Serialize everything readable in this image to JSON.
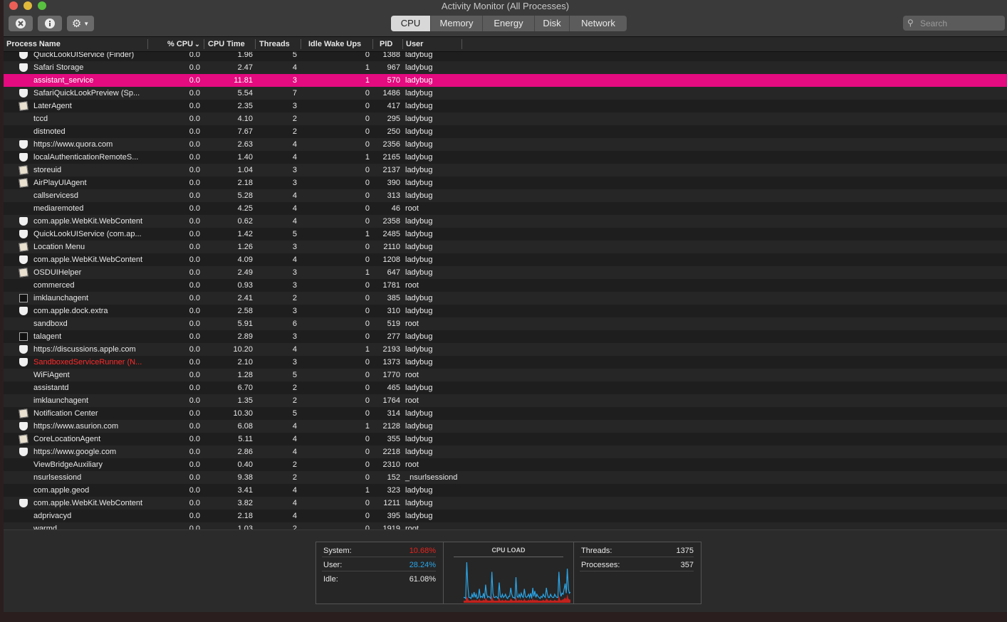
{
  "window": {
    "title": "Activity Monitor (All Processes)"
  },
  "toolbar": {
    "tabs": [
      {
        "label": "CPU",
        "active": true,
        "width": 55
      },
      {
        "label": "Memory",
        "active": false,
        "width": 72
      },
      {
        "label": "Energy",
        "active": false,
        "width": 72
      },
      {
        "label": "Disk",
        "active": false,
        "width": 48
      },
      {
        "label": "Network",
        "active": false,
        "width": 80
      }
    ],
    "search_placeholder": "Search"
  },
  "columns": {
    "name": "Process Name",
    "cpu": "% CPU",
    "cpu_time": "CPU Time",
    "threads": "Threads",
    "idle": "Idle Wake Ups",
    "pid": "PID",
    "user": "User"
  },
  "processes": [
    {
      "name": "QuickLookUIService (Finder)",
      "cpu": "0.0",
      "time": "1.96",
      "threads": "5",
      "idle": "0",
      "pid": "1388",
      "user": "ladybug",
      "icon": "shield"
    },
    {
      "name": "Safari Storage",
      "cpu": "0.0",
      "time": "2.47",
      "threads": "4",
      "idle": "1",
      "pid": "967",
      "user": "ladybug",
      "icon": "shield"
    },
    {
      "name": "assistant_service",
      "cpu": "0.0",
      "time": "11.81",
      "threads": "3",
      "idle": "1",
      "pid": "570",
      "user": "ladybug",
      "icon": "none",
      "selected": true
    },
    {
      "name": "SafariQuickLookPreview (Sp...",
      "cpu": "0.0",
      "time": "5.54",
      "threads": "7",
      "idle": "0",
      "pid": "1486",
      "user": "ladybug",
      "icon": "shield"
    },
    {
      "name": "LaterAgent",
      "cpu": "0.0",
      "time": "2.35",
      "threads": "3",
      "idle": "0",
      "pid": "417",
      "user": "ladybug",
      "icon": "app"
    },
    {
      "name": "tccd",
      "cpu": "0.0",
      "time": "4.10",
      "threads": "2",
      "idle": "0",
      "pid": "295",
      "user": "ladybug",
      "icon": "none"
    },
    {
      "name": "distnoted",
      "cpu": "0.0",
      "time": "7.67",
      "threads": "2",
      "idle": "0",
      "pid": "250",
      "user": "ladybug",
      "icon": "none"
    },
    {
      "name": "https://www.quora.com",
      "cpu": "0.0",
      "time": "2.63",
      "threads": "4",
      "idle": "0",
      "pid": "2356",
      "user": "ladybug",
      "icon": "shield"
    },
    {
      "name": "localAuthenticationRemoteS...",
      "cpu": "0.0",
      "time": "1.40",
      "threads": "4",
      "idle": "1",
      "pid": "2165",
      "user": "ladybug",
      "icon": "shield"
    },
    {
      "name": "storeuid",
      "cpu": "0.0",
      "time": "1.04",
      "threads": "3",
      "idle": "0",
      "pid": "2137",
      "user": "ladybug",
      "icon": "app"
    },
    {
      "name": "AirPlayUIAgent",
      "cpu": "0.0",
      "time": "2.18",
      "threads": "3",
      "idle": "0",
      "pid": "390",
      "user": "ladybug",
      "icon": "app"
    },
    {
      "name": "callservicesd",
      "cpu": "0.0",
      "time": "5.28",
      "threads": "4",
      "idle": "0",
      "pid": "313",
      "user": "ladybug",
      "icon": "none"
    },
    {
      "name": "mediaremoted",
      "cpu": "0.0",
      "time": "4.25",
      "threads": "4",
      "idle": "0",
      "pid": "46",
      "user": "root",
      "icon": "none"
    },
    {
      "name": "com.apple.WebKit.WebContent",
      "cpu": "0.0",
      "time": "0.62",
      "threads": "4",
      "idle": "0",
      "pid": "2358",
      "user": "ladybug",
      "icon": "shield"
    },
    {
      "name": "QuickLookUIService (com.ap...",
      "cpu": "0.0",
      "time": "1.42",
      "threads": "5",
      "idle": "1",
      "pid": "2485",
      "user": "ladybug",
      "icon": "shield"
    },
    {
      "name": "Location Menu",
      "cpu": "0.0",
      "time": "1.26",
      "threads": "3",
      "idle": "0",
      "pid": "2110",
      "user": "ladybug",
      "icon": "app"
    },
    {
      "name": "com.apple.WebKit.WebContent",
      "cpu": "0.0",
      "time": "4.09",
      "threads": "4",
      "idle": "0",
      "pid": "1208",
      "user": "ladybug",
      "icon": "shield"
    },
    {
      "name": "OSDUIHelper",
      "cpu": "0.0",
      "time": "2.49",
      "threads": "3",
      "idle": "1",
      "pid": "647",
      "user": "ladybug",
      "icon": "app"
    },
    {
      "name": "commerced",
      "cpu": "0.0",
      "time": "0.93",
      "threads": "3",
      "idle": "0",
      "pid": "1781",
      "user": "root",
      "icon": "none"
    },
    {
      "name": "imklaunchagent",
      "cpu": "0.0",
      "time": "2.41",
      "threads": "2",
      "idle": "0",
      "pid": "385",
      "user": "ladybug",
      "icon": "term"
    },
    {
      "name": "com.apple.dock.extra",
      "cpu": "0.0",
      "time": "2.58",
      "threads": "3",
      "idle": "0",
      "pid": "310",
      "user": "ladybug",
      "icon": "shield"
    },
    {
      "name": "sandboxd",
      "cpu": "0.0",
      "time": "5.91",
      "threads": "6",
      "idle": "0",
      "pid": "519",
      "user": "root",
      "icon": "none"
    },
    {
      "name": "talagent",
      "cpu": "0.0",
      "time": "2.89",
      "threads": "3",
      "idle": "0",
      "pid": "277",
      "user": "ladybug",
      "icon": "term"
    },
    {
      "name": "https://discussions.apple.com",
      "cpu": "0.0",
      "time": "10.20",
      "threads": "4",
      "idle": "1",
      "pid": "2193",
      "user": "ladybug",
      "icon": "shield"
    },
    {
      "name": "SandboxedServiceRunner (N...",
      "cpu": "0.0",
      "time": "2.10",
      "threads": "3",
      "idle": "0",
      "pid": "1373",
      "user": "ladybug",
      "icon": "shield",
      "warn": true
    },
    {
      "name": "WiFiAgent",
      "cpu": "0.0",
      "time": "1.28",
      "threads": "5",
      "idle": "0",
      "pid": "1770",
      "user": "root",
      "icon": "none"
    },
    {
      "name": "assistantd",
      "cpu": "0.0",
      "time": "6.70",
      "threads": "2",
      "idle": "0",
      "pid": "465",
      "user": "ladybug",
      "icon": "none"
    },
    {
      "name": "imklaunchagent",
      "cpu": "0.0",
      "time": "1.35",
      "threads": "2",
      "idle": "0",
      "pid": "1764",
      "user": "root",
      "icon": "none"
    },
    {
      "name": "Notification Center",
      "cpu": "0.0",
      "time": "10.30",
      "threads": "5",
      "idle": "0",
      "pid": "314",
      "user": "ladybug",
      "icon": "app"
    },
    {
      "name": "https://www.asurion.com",
      "cpu": "0.0",
      "time": "6.08",
      "threads": "4",
      "idle": "1",
      "pid": "2128",
      "user": "ladybug",
      "icon": "shield"
    },
    {
      "name": "CoreLocationAgent",
      "cpu": "0.0",
      "time": "5.11",
      "threads": "4",
      "idle": "0",
      "pid": "355",
      "user": "ladybug",
      "icon": "app"
    },
    {
      "name": "https://www.google.com",
      "cpu": "0.0",
      "time": "2.86",
      "threads": "4",
      "idle": "0",
      "pid": "2218",
      "user": "ladybug",
      "icon": "shield"
    },
    {
      "name": "ViewBridgeAuxiliary",
      "cpu": "0.0",
      "time": "0.40",
      "threads": "2",
      "idle": "0",
      "pid": "2310",
      "user": "root",
      "icon": "none"
    },
    {
      "name": "nsurlsessiond",
      "cpu": "0.0",
      "time": "9.38",
      "threads": "2",
      "idle": "0",
      "pid": "152",
      "user": "_nsurlsessiond",
      "icon": "none"
    },
    {
      "name": "com.apple.geod",
      "cpu": "0.0",
      "time": "3.41",
      "threads": "4",
      "idle": "1",
      "pid": "323",
      "user": "ladybug",
      "icon": "none"
    },
    {
      "name": "com.apple.WebKit.WebContent",
      "cpu": "0.0",
      "time": "3.82",
      "threads": "4",
      "idle": "0",
      "pid": "1211",
      "user": "ladybug",
      "icon": "shield"
    },
    {
      "name": "adprivacyd",
      "cpu": "0.0",
      "time": "2.18",
      "threads": "4",
      "idle": "0",
      "pid": "395",
      "user": "ladybug",
      "icon": "none"
    },
    {
      "name": "warmd",
      "cpu": "0.0",
      "time": "1.03",
      "threads": "2",
      "idle": "0",
      "pid": "1919",
      "user": "root",
      "icon": "none"
    }
  ],
  "stats": {
    "system_label": "System:",
    "system_value": "10.68%",
    "system_color": "#e8221c",
    "user_label": "User:",
    "user_value": "28.24%",
    "user_color": "#2aa6e8",
    "idle_label": "Idle:",
    "idle_value": "61.08%",
    "cpu_load_title": "CPU LOAD",
    "threads_label": "Threads:",
    "threads_value": "1375",
    "processes_label": "Processes:",
    "processes_value": "357"
  },
  "cpu_load_user": [
    3,
    3,
    2,
    32,
    12,
    3,
    3,
    2,
    5,
    3,
    7,
    3,
    5,
    2,
    3,
    9,
    3,
    4,
    3,
    6,
    2,
    12,
    5,
    3,
    4,
    3,
    2,
    22,
    6,
    3,
    3,
    4,
    3,
    2,
    14,
    4,
    3,
    5,
    3,
    4,
    5,
    3,
    2,
    4,
    4,
    10,
    5,
    3,
    3,
    2,
    18,
    4,
    3,
    5,
    3,
    6,
    4,
    3,
    9,
    4,
    3,
    4,
    5,
    3,
    6,
    2,
    10,
    4,
    8,
    3,
    5,
    4,
    3,
    2,
    4,
    3,
    5,
    4,
    3,
    10,
    5,
    3,
    3,
    5,
    4,
    3,
    3,
    5,
    4,
    3,
    3,
    22,
    8,
    4,
    6,
    5,
    9,
    13,
    6,
    24,
    9,
    6,
    7
  ],
  "cpu_load_system": [
    2,
    2,
    2,
    6,
    4,
    2,
    2,
    2,
    3,
    2,
    3,
    2,
    3,
    2,
    2,
    4,
    2,
    2,
    2,
    3,
    2,
    5,
    3,
    2,
    2,
    2,
    2,
    7,
    3,
    2,
    2,
    2,
    2,
    2,
    5,
    2,
    2,
    3,
    2,
    2,
    3,
    2,
    2,
    2,
    2,
    4,
    3,
    2,
    2,
    2,
    6,
    2,
    2,
    3,
    2,
    3,
    2,
    2,
    4,
    2,
    2,
    2,
    3,
    2,
    3,
    2,
    4,
    2,
    3,
    2,
    3,
    2,
    2,
    2,
    2,
    2,
    3,
    2,
    2,
    4,
    3,
    2,
    2,
    3,
    2,
    2,
    2,
    3,
    2,
    2,
    2,
    7,
    3,
    2,
    3,
    3,
    4,
    5,
    3,
    8,
    4,
    3,
    3
  ]
}
